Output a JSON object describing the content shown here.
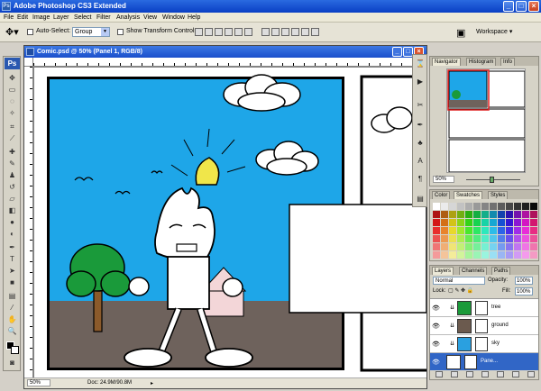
{
  "app": {
    "title": "Adobe Photoshop CS3 Extended",
    "logo": "Ps"
  },
  "window_buttons": {
    "minimize": "_",
    "maximize": "□",
    "close": "×"
  },
  "menu": [
    "File",
    "Edit",
    "Image",
    "Layer",
    "Select",
    "Filter",
    "Analysis",
    "View",
    "Window",
    "Help"
  ],
  "options": {
    "tool_icon": "move-tool-icon",
    "auto_select_label": "Auto-Select:",
    "auto_select_value": "Group",
    "transform_label": "Show Transform Controls",
    "workspace_label": "Workspace ▾"
  },
  "document": {
    "title": "Comic.psd @ 50% (Panel 1, RGB/8)",
    "zoom": "50%",
    "doc_info": "Doc: 24.9M/90.8M"
  },
  "navigator": {
    "tabs": [
      "Navigator",
      "Histogram",
      "Info"
    ],
    "zoom": "50%"
  },
  "swatches": {
    "tabs": [
      "Color",
      "Swatches",
      "Styles"
    ]
  },
  "layers": {
    "tabs": [
      "Layers",
      "Channels",
      "Paths"
    ],
    "mode": "Normal",
    "opacity_label": "Opacity:",
    "opacity": "100%",
    "lock_label": "Lock:",
    "fill_label": "Fill:",
    "fill": "100%",
    "items": [
      {
        "name": "tree",
        "color": "#1a9a3a"
      },
      {
        "name": "ground",
        "color": "#6b5a4e"
      },
      {
        "name": "sky",
        "color": "#2aa0e0"
      },
      {
        "name": "Pane...",
        "color": "#ffffff"
      }
    ]
  },
  "colors": {
    "sky": "#1ea6e8",
    "ground": "#6e625c",
    "tree": "#1a9a3a",
    "trunk": "#8b5a2b",
    "flame": "#f0e64a",
    "house": "#f3d6d8",
    "selection": "#3166c6"
  }
}
